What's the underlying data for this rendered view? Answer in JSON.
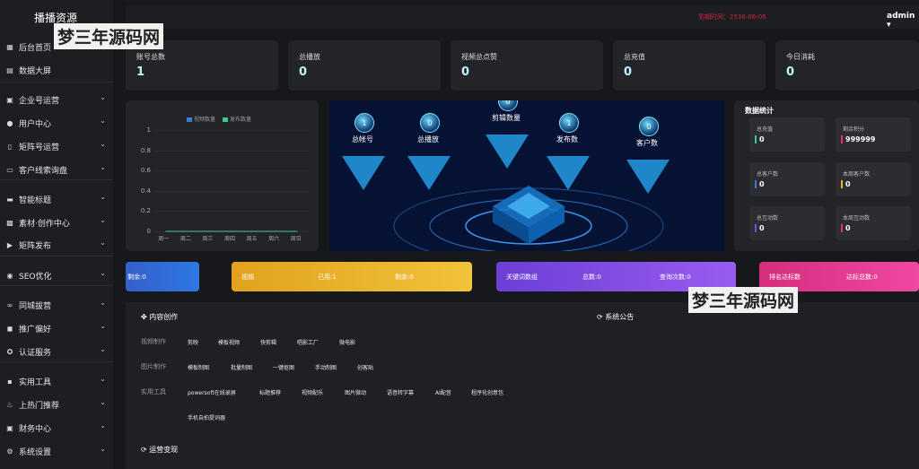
{
  "app": {
    "title": "播播资源",
    "expire": "到期时间：2536-06-06",
    "user": "admin"
  },
  "watermark": "梦三年源码网",
  "sidebar": {
    "items": [
      {
        "label": "后台首页",
        "icon": "grid-icon",
        "caret": false
      },
      {
        "label": "数据大屏",
        "icon": "chart-icon",
        "caret": false
      },
      {
        "label": "企业号运营",
        "icon": "building-icon",
        "caret": true
      },
      {
        "label": "用户中心",
        "icon": "user-icon",
        "caret": true
      },
      {
        "label": "矩阵号运营",
        "icon": "phone-icon",
        "caret": true
      },
      {
        "label": "客户线索询盘",
        "icon": "folder-icon",
        "caret": true
      },
      {
        "label": "智能标题",
        "icon": "keyboard-icon",
        "caret": true
      },
      {
        "label": "素材·创作中心",
        "icon": "image-icon",
        "caret": true
      },
      {
        "label": "矩阵发布",
        "icon": "video-icon",
        "caret": true
      },
      {
        "label": "SEO优化",
        "icon": "target-icon",
        "caret": true
      },
      {
        "label": "同城拔营",
        "icon": "link-icon",
        "caret": true
      },
      {
        "label": "推广偏好",
        "icon": "bag-icon",
        "caret": true
      },
      {
        "label": "认证服务",
        "icon": "badge-icon",
        "caret": true
      },
      {
        "label": "实用工具",
        "icon": "tool-icon",
        "caret": true
      },
      {
        "label": "上热门推荐",
        "icon": "fire-icon",
        "caret": true
      },
      {
        "label": "财务中心",
        "icon": "wallet-icon",
        "caret": true
      },
      {
        "label": "系统设置",
        "icon": "settings-icon",
        "caret": true
      }
    ]
  },
  "cards": [
    {
      "label": "账号总数",
      "value": "1"
    },
    {
      "label": "总播放",
      "value": "0"
    },
    {
      "label": "视频总点赞",
      "value": "0"
    },
    {
      "label": "总充值",
      "value": "0"
    },
    {
      "label": "今日消耗",
      "value": "0"
    }
  ],
  "chart_data": {
    "type": "line",
    "categories": [
      "周一",
      "周二",
      "周三",
      "周四",
      "周五",
      "周六",
      "周日"
    ],
    "series": [
      {
        "name": "视频数量",
        "values": [
          0,
          0,
          0,
          0,
          0,
          0,
          0
        ],
        "color": "#3a7bd5"
      },
      {
        "name": "发布数量",
        "values": [
          0,
          0,
          0,
          0,
          0,
          0,
          0
        ],
        "color": "#3cc78c"
      }
    ],
    "ylim": [
      0,
      1
    ],
    "yticks": [
      "1",
      "0.8",
      "0.6",
      "0.4",
      "0.2",
      "0"
    ]
  },
  "viz": [
    {
      "value": "1",
      "label": "总帐号"
    },
    {
      "value": "0",
      "label": "总播放"
    },
    {
      "value": "0",
      "label": "剪辑数量"
    },
    {
      "value": "1",
      "label": "发布数"
    },
    {
      "value": "0",
      "label": "客户数"
    }
  ],
  "stats": {
    "title": "数据统计",
    "items": [
      {
        "label": "总充值",
        "value": "0",
        "color": "#3cc78c"
      },
      {
        "label": "剩余积分",
        "value": "999999",
        "color": "#e8326b"
      },
      {
        "label": "总客户数",
        "value": "0",
        "color": "#3a7bd5"
      },
      {
        "label": "本周客户数",
        "value": "0",
        "color": "#f0b429"
      },
      {
        "label": "总互动数",
        "value": "0",
        "color": "#7b4ee8"
      },
      {
        "label": "本周互动数",
        "value": "0",
        "color": "#e8326b"
      }
    ]
  },
  "bands": [
    {
      "texts": [
        "剩余:0"
      ]
    },
    {
      "texts": [
        "视频",
        "已用:1",
        "剩余:0"
      ]
    },
    {
      "texts": [
        "关键词数组",
        "总数:0",
        "查询次数:0"
      ]
    },
    {
      "texts": [
        "排名达标数",
        "达标总数:0"
      ]
    }
  ],
  "creation": {
    "title": "内容创作",
    "notice": "系统公告",
    "ops": "运营变现",
    "rows": [
      {
        "label": "视频制作",
        "tools": [
          "剪映",
          "模板视频",
          "快剪辑",
          "唱影工厂",
          "微电影"
        ]
      },
      {
        "label": "图片制作",
        "tools": [
          "模板制图",
          "批量制图",
          "一键抠图",
          "手动制图",
          "创客贴"
        ]
      },
      {
        "label": "实用工具",
        "tools": [
          "powersoft在线录屏",
          "标题推荐",
          "视频配乐",
          "图片微动",
          "语音转字幕",
          "AI配音",
          "程序化创意包"
        ]
      },
      {
        "label": "",
        "tools": [
          "手机自拍提词器"
        ]
      }
    ]
  }
}
